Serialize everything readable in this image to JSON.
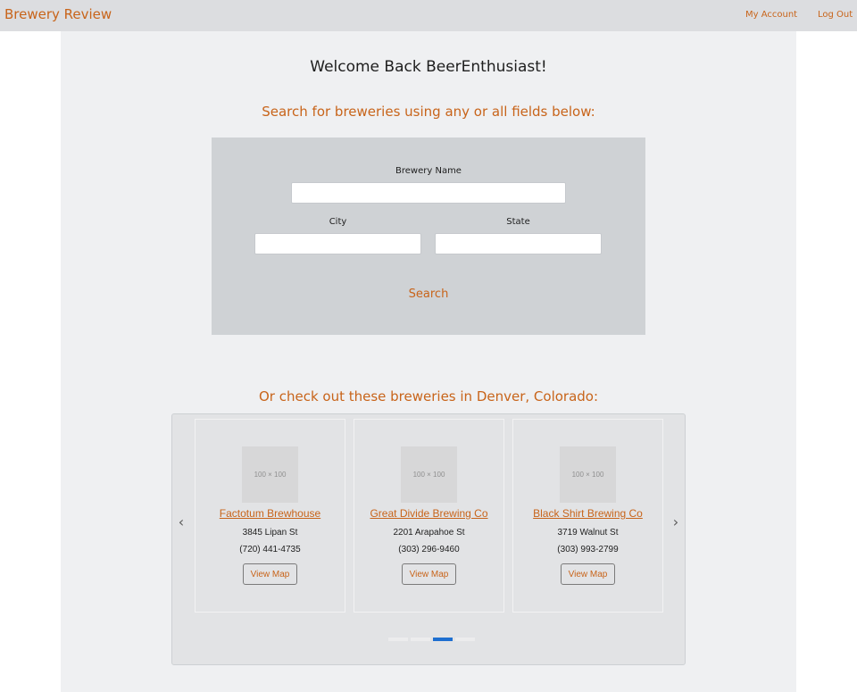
{
  "header": {
    "brand": "Brewery Review",
    "nav": {
      "account": "My Account",
      "logout": "Log Out"
    }
  },
  "main": {
    "welcome": "Welcome Back BeerEnthusiast!",
    "search_heading": "Search for breweries using any or all fields below:",
    "search_form": {
      "name_label": "Brewery Name",
      "name_value": "",
      "city_label": "City",
      "city_value": "",
      "state_label": "State",
      "state_value": "",
      "search_label": "Search"
    },
    "featured_heading": "Or check out these breweries in Denver, Colorado:",
    "carousel": {
      "prev_icon": "‹",
      "next_icon": "›",
      "active_slide": 3,
      "slide_count": 4,
      "cards": [
        {
          "thumb": "100 × 100",
          "name": "Factotum Brewhouse",
          "address": "3845 Lipan St",
          "phone": "(720) 441-4735",
          "map_label": "View Map"
        },
        {
          "thumb": "100 × 100",
          "name": "Great Divide Brewing Co",
          "address": "2201 Arapahoe St",
          "phone": "(303) 296-9460",
          "map_label": "View Map"
        },
        {
          "thumb": "100 × 100",
          "name": "Black Shirt Brewing Co",
          "address": "3719 Walnut St",
          "phone": "(303) 993-2799",
          "map_label": "View Map"
        }
      ]
    }
  },
  "colors": {
    "accent": "#c8641a",
    "indicator_active": "#1e6fd0"
  }
}
